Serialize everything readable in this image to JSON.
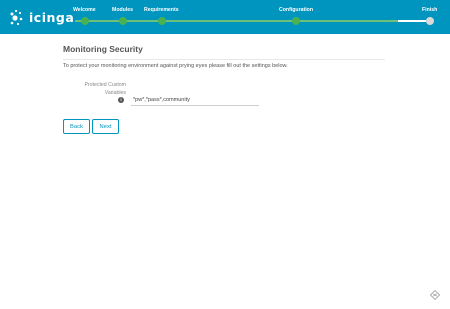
{
  "app": {
    "logo_text": "icinga"
  },
  "wizard": {
    "steps": [
      {
        "label": "Welcome",
        "state": "done"
      },
      {
        "label": "Modules",
        "state": "done"
      },
      {
        "label": "Requirements",
        "state": "done"
      },
      {
        "label": "Configuration",
        "state": "current"
      },
      {
        "label": "Finish",
        "state": "todo"
      }
    ]
  },
  "page": {
    "title": "Monitoring Security",
    "intro": "To protect your monitoring environment against prying eyes please fill out the settings below.",
    "field": {
      "label": "Protected Custom Variables",
      "value": "*pw*,*pass*,community",
      "info_icon": "info-circle-icon"
    },
    "buttons": {
      "back": "Back",
      "next": "Next"
    }
  },
  "colors": {
    "header": "#0095bf",
    "step_done": "#49b14f",
    "step_pending": "#d9d9d9",
    "button_accent": "#0095bf"
  }
}
